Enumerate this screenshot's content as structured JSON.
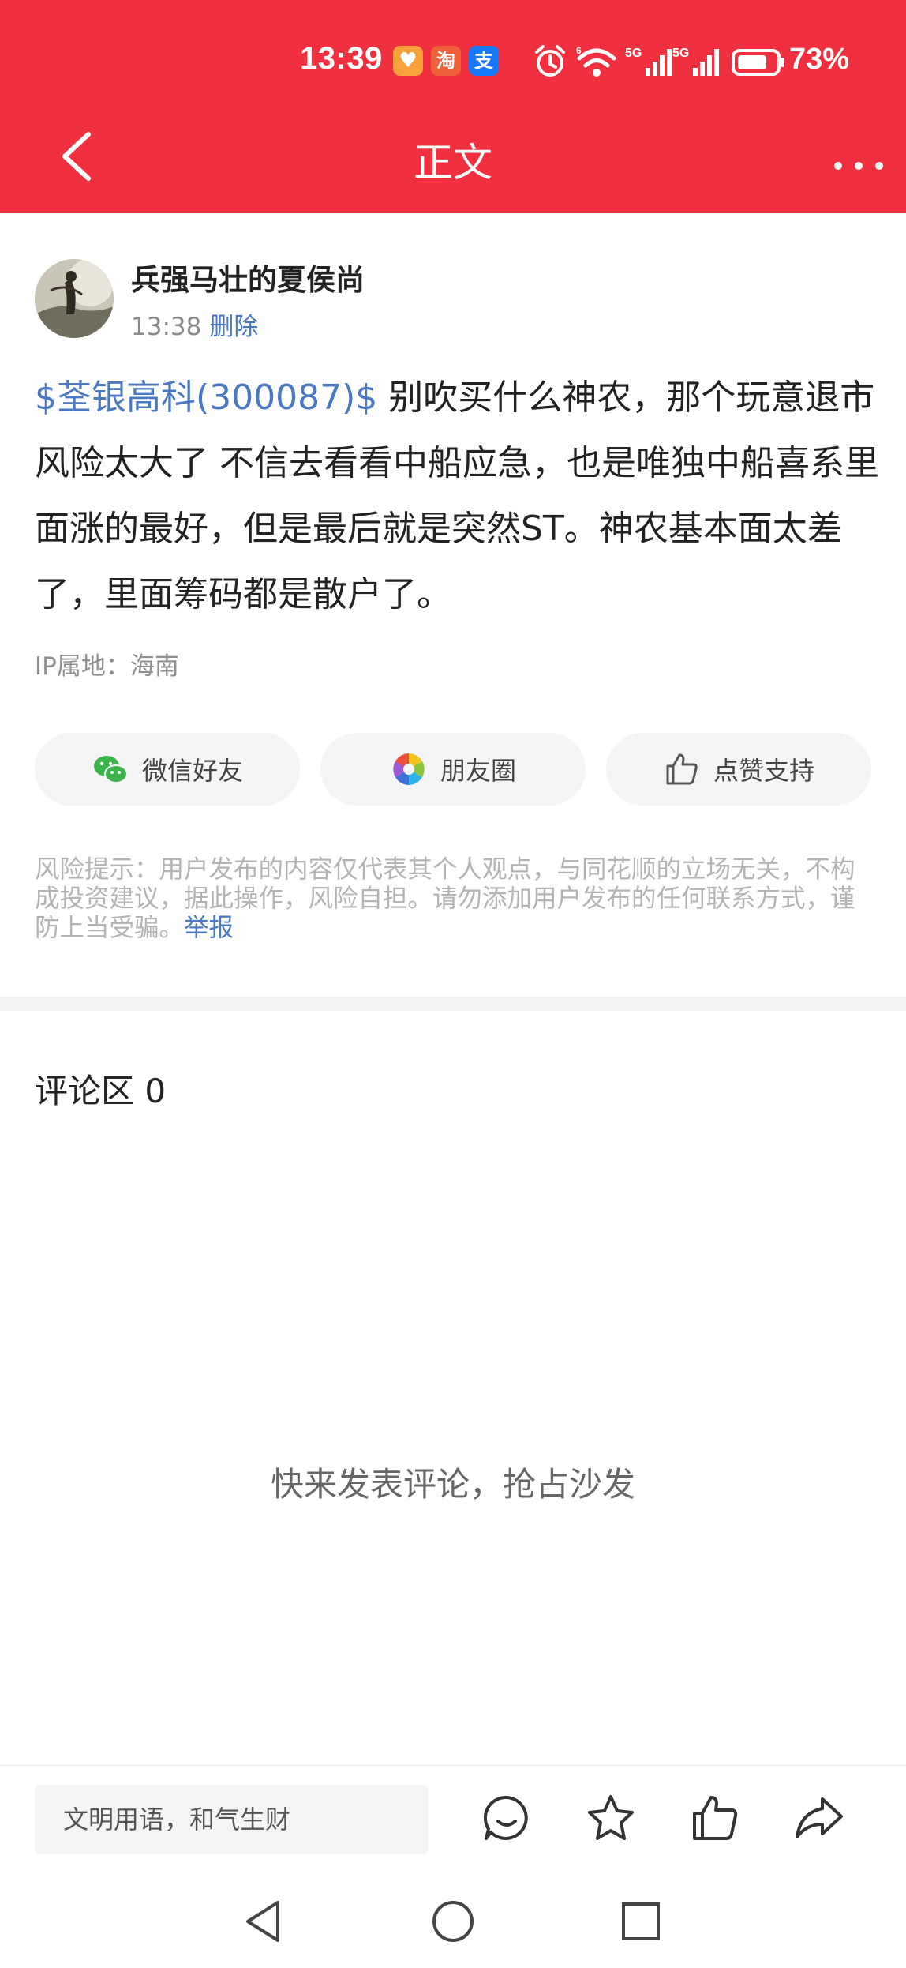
{
  "status_bar": {
    "time": "13:39",
    "apps": [
      {
        "icon": "shield-heart-app-icon",
        "color": "#f7a23b",
        "glyph": "♥"
      },
      {
        "icon": "taobao-app-icon",
        "color": "#f0603a",
        "glyph": "淘"
      },
      {
        "icon": "alipay-app-icon",
        "color": "#1677ff",
        "glyph": "支"
      }
    ],
    "network1": "5G",
    "network2": "5G",
    "battery": "73%"
  },
  "nav": {
    "title": "正文"
  },
  "post": {
    "author": "兵强马壮的夏侯尚",
    "time": "13:38",
    "delete_label": "删除",
    "stock_tag": "$荃银高科(300087)$",
    "content": " 别吹买什么神农，那个玩意退市风险太大了 不信去看看中船应急，也是唯独中船喜系里面涨的最好，但是最后就是突然ST。神农基本面太差了，里面筹码都是散户了。",
    "ip_location": "IP属地：海南"
  },
  "share": {
    "wechat": "微信好友",
    "moments": "朋友圈",
    "like": "点赞支持"
  },
  "disclaimer": {
    "text": "风险提示：用户发布的内容仅代表其个人观点，与同花顺的立场无关，不构成投资建议，据此操作，风险自担。请勿添加用户发布的任何联系方式，谨防上当受骗。",
    "report_label": "举报"
  },
  "comments": {
    "title": "评论区 0",
    "empty_hint": "快来发表评论，抢占沙发"
  },
  "bottom_bar": {
    "input_placeholder": "文明用语，和气生财"
  },
  "colors": {
    "brand_red": "#f1303f",
    "link_blue": "#4a78c2"
  }
}
